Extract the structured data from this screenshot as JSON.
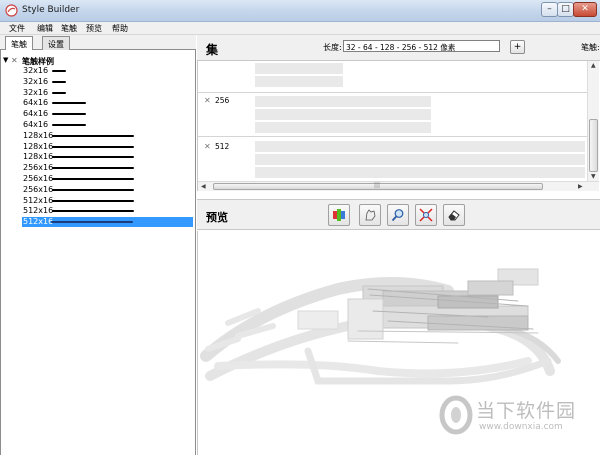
{
  "window": {
    "title": "Style Builder",
    "min": "–",
    "max": "□",
    "close": "✕"
  },
  "menu": [
    "文件",
    "编辑",
    "笔触",
    "预览",
    "帮助"
  ],
  "left_tabs": [
    "笔触",
    "设置"
  ],
  "tree": {
    "root_label": "笔触样例",
    "rows": [
      "32x16",
      "32x16",
      "32x16",
      "64x16",
      "64x16",
      "64x16",
      "128x16",
      "128x16",
      "128x16",
      "256x16",
      "256x16",
      "256x16",
      "512x16",
      "512x16",
      "512x16"
    ],
    "selected_index": 14
  },
  "set_panel": {
    "title": "集",
    "length_label": "长度:",
    "length_value": "32 - 64 - 128 - 256 - 512 像素",
    "add_label": "+",
    "stroke_label": "笔触:",
    "rows": [
      {
        "label": "256"
      },
      {
        "label": "512"
      }
    ]
  },
  "preview": {
    "title": "预览",
    "tools": [
      "color-icon",
      "hand-icon",
      "zoom-icon",
      "zoom-extents-icon",
      "eraser-icon"
    ]
  },
  "watermark": {
    "text": "当下软件园",
    "url": "www.downxia.com"
  }
}
